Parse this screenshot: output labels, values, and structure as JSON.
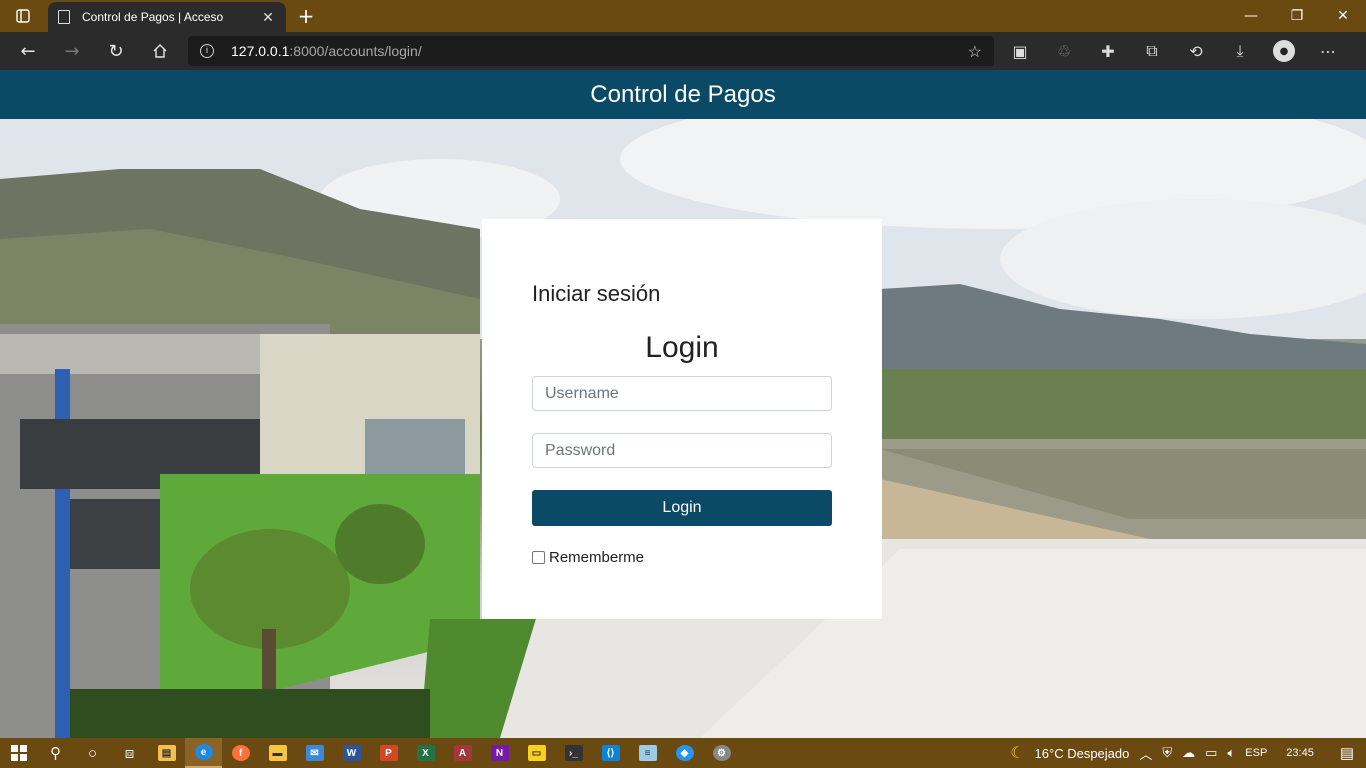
{
  "browser": {
    "tab_title": "Control de Pagos | Acceso",
    "url_host": "127.0.0.1",
    "url_rest": ":8000/accounts/login/"
  },
  "page": {
    "header_title": "Control de Pagos",
    "subtitle": "Iniciar sesión",
    "heading": "Login",
    "username_placeholder": "Username",
    "password_placeholder": "Password",
    "login_button": "Login",
    "remember_label": "Rememberme"
  },
  "taskbar": {
    "weather": "16°C  Despejado",
    "language": "ESP",
    "time": "23:45"
  },
  "colors": {
    "header": "#0a4a66",
    "titlebar": "#6b4a12",
    "button": "#0a4a66"
  }
}
